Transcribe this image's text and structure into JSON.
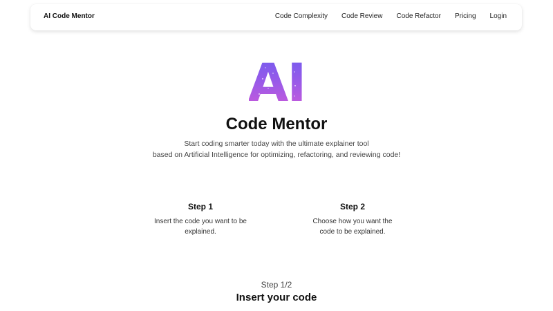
{
  "header": {
    "brand": "AI Code Mentor",
    "nav": [
      {
        "label": "Code Complexity"
      },
      {
        "label": "Code Review"
      },
      {
        "label": "Code Refactor"
      },
      {
        "label": "Pricing"
      },
      {
        "label": "Login"
      }
    ]
  },
  "hero": {
    "logo_text": "AI",
    "logo_icon": "ai-logo-icon",
    "title": "Code Mentor",
    "description_line1": "Start coding smarter today with the ultimate explainer tool",
    "description_line2": "based on Artificial Intelligence for optimizing, refactoring, and reviewing code!",
    "colors": {
      "gradient_top": "#6d5cf0",
      "gradient_mid": "#9a5ae8",
      "gradient_bottom": "#d05ad8"
    }
  },
  "steps": [
    {
      "title": "Step 1",
      "line1": "Insert the code you want to be",
      "line2": "explained."
    },
    {
      "title": "Step 2",
      "line1": "Choose how you want the",
      "line2": "code to be explained."
    }
  ],
  "progress": {
    "label": "Step 1/2",
    "section_title": "Insert your code"
  }
}
